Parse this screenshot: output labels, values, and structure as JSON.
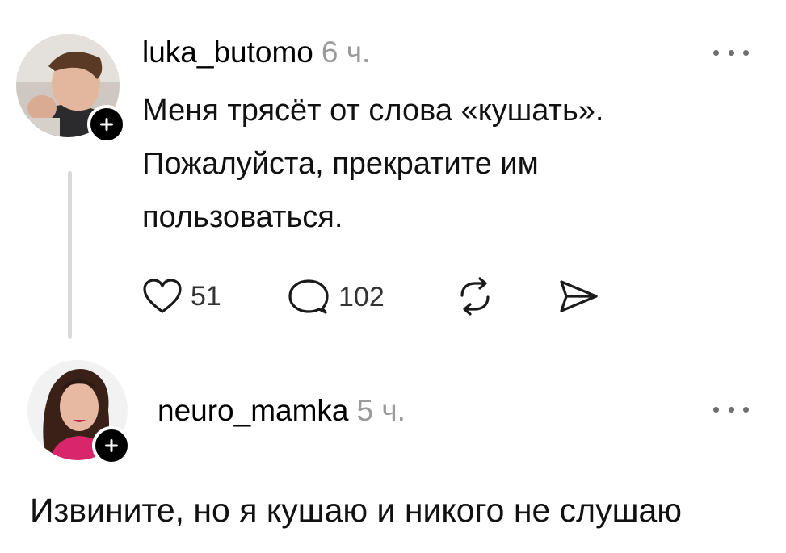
{
  "post": {
    "username": "luka_butomo",
    "time": "6 ч.",
    "text_lines": [
      "Меня трясёт от слова «кушать».",
      "Пожалуйста, прекратите им",
      "пользоваться."
    ],
    "likes": "51",
    "comments": "102",
    "icons": {
      "like": "heart-icon",
      "comment": "comment-bubble-icon",
      "repost": "repost-icon",
      "share": "share-send-icon",
      "more": "more-dots-icon",
      "follow": "plus-icon"
    }
  },
  "reply": {
    "username": "neuro_mamka",
    "time": "5 ч.",
    "text": "Извините, но я кушаю и никого не слушаю",
    "icons": {
      "more": "more-dots-icon",
      "follow": "plus-icon"
    }
  }
}
